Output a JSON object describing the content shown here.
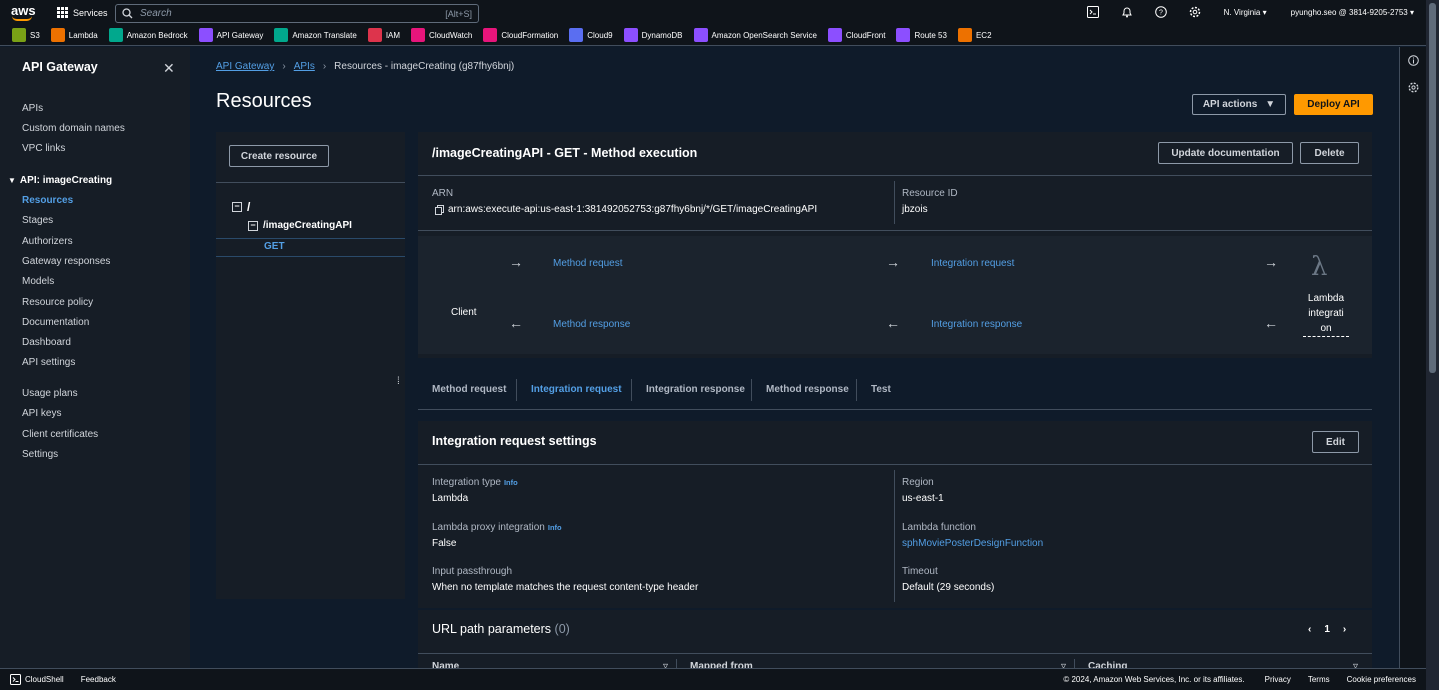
{
  "topbar": {
    "logo": "aws",
    "services_label": "Services",
    "search_placeholder": "Search",
    "search_shortcut": "[Alt+S]",
    "region": "N. Virginia",
    "account": "pyungho.seo @ 3814-9205-2753"
  },
  "favorites": [
    {
      "label": "S3",
      "color": "#7aa116"
    },
    {
      "label": "Lambda",
      "color": "#ed7100"
    },
    {
      "label": "Amazon Bedrock",
      "color": "#01a88d"
    },
    {
      "label": "API Gateway",
      "color": "#8c4fff"
    },
    {
      "label": "Amazon Translate",
      "color": "#01a88d"
    },
    {
      "label": "IAM",
      "color": "#dd344c"
    },
    {
      "label": "CloudWatch",
      "color": "#e7157b"
    },
    {
      "label": "CloudFormation",
      "color": "#e7157b"
    },
    {
      "label": "Cloud9",
      "color": "#5a6ef1"
    },
    {
      "label": "DynamoDB",
      "color": "#8c4fff"
    },
    {
      "label": "Amazon OpenSearch Service",
      "color": "#8c4fff"
    },
    {
      "label": "CloudFront",
      "color": "#8c4fff"
    },
    {
      "label": "Route 53",
      "color": "#8c4fff"
    },
    {
      "label": "EC2",
      "color": "#ed7100"
    }
  ],
  "sidebar": {
    "title": "API Gateway",
    "items1": [
      "APIs",
      "Custom domain names",
      "VPC links"
    ],
    "group": "API: imageCreating",
    "items2": [
      "Resources",
      "Stages",
      "Authorizers",
      "Gateway responses",
      "Models",
      "Resource policy",
      "Documentation",
      "Dashboard",
      "API settings"
    ],
    "items3": [
      "Usage plans",
      "API keys",
      "Client certificates",
      "Settings"
    ]
  },
  "breadcrumb": {
    "b1": "API Gateway",
    "b2": "APIs",
    "b3": "Resources - imageCreating (g87fhy6bnj)"
  },
  "page": {
    "title": "Resources",
    "api_actions": "API actions",
    "deploy": "Deploy API"
  },
  "tree": {
    "create": "Create resource",
    "root": "/",
    "child": "/imageCreatingAPI",
    "method": "GET"
  },
  "execution": {
    "title": "/imageCreatingAPI - GET - Method execution",
    "update_doc": "Update documentation",
    "delete": "Delete",
    "arn_label": "ARN",
    "arn_value": "arn:aws:execute-api:us-east-1:381492052753:g87fhy6bnj/*/GET/imageCreatingAPI",
    "resource_id_label": "Resource ID",
    "resource_id_value": "jbzois",
    "client": "Client",
    "method_request": "Method request",
    "integration_request": "Integration request",
    "method_response": "Method response",
    "integration_response": "Integration response",
    "lambda_1": "Lambda",
    "lambda_2": "integrati",
    "lambda_3": "on"
  },
  "tabs": [
    "Method request",
    "Integration request",
    "Integration response",
    "Method response",
    "Test"
  ],
  "settings": {
    "title": "Integration request settings",
    "edit": "Edit",
    "info": "Info",
    "type_label": "Integration type",
    "type_value": "Lambda",
    "proxy_label": "Lambda proxy integration",
    "proxy_value": "False",
    "passthrough_label": "Input passthrough",
    "passthrough_value": "When no template matches the request content-type header",
    "region_label": "Region",
    "region_value": "us-east-1",
    "function_label": "Lambda function",
    "function_value": "sphMoviePosterDesignFunction",
    "timeout_label": "Timeout",
    "timeout_value": "Default (29 seconds)"
  },
  "url_params": {
    "title": "URL path parameters",
    "count": "(0)",
    "page": "1",
    "col_name": "Name",
    "col_mapped": "Mapped from",
    "col_caching": "Caching"
  },
  "footer": {
    "cloudshell": "CloudShell",
    "feedback": "Feedback",
    "copyright": "© 2024, Amazon Web Services, Inc. or its affiliates.",
    "privacy": "Privacy",
    "terms": "Terms",
    "cookies": "Cookie preferences"
  }
}
